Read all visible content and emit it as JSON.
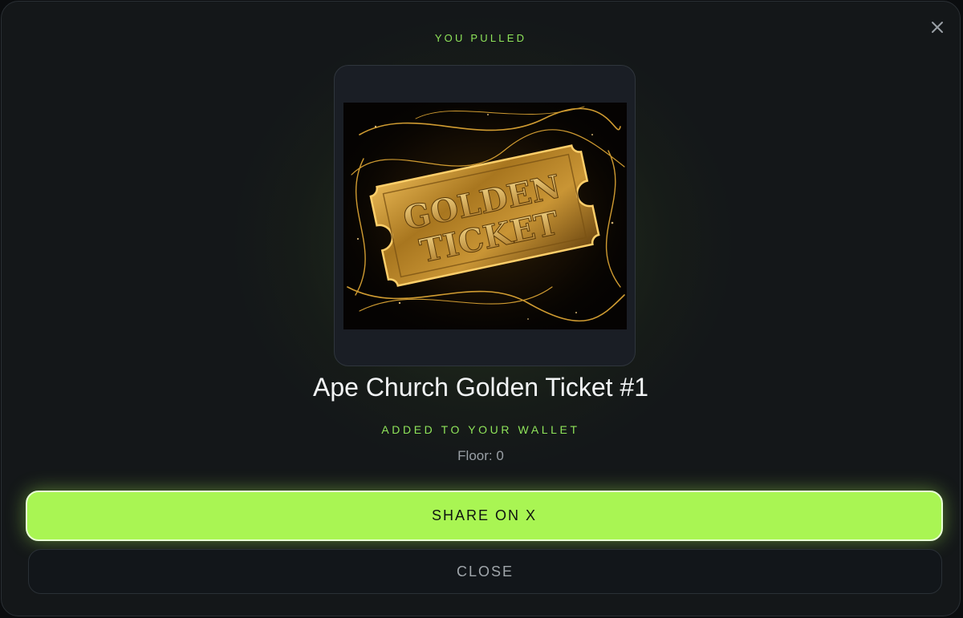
{
  "header": {
    "eyebrow": "YOU PULLED"
  },
  "close_icon": "close-icon",
  "nft": {
    "name": "Ape Church Golden Ticket #1",
    "ticket_line1": "GOLDEN",
    "ticket_line2": "TICKET",
    "status": "ADDED TO YOUR WALLET",
    "floor_text": "Floor: 0"
  },
  "actions": {
    "share_label": "SHARE ON X",
    "close_label": "CLOSE"
  },
  "colors": {
    "accent": "#a9f553",
    "accent_text": "#8fe45a",
    "background": "#141719",
    "gold": "#d4a03a"
  }
}
